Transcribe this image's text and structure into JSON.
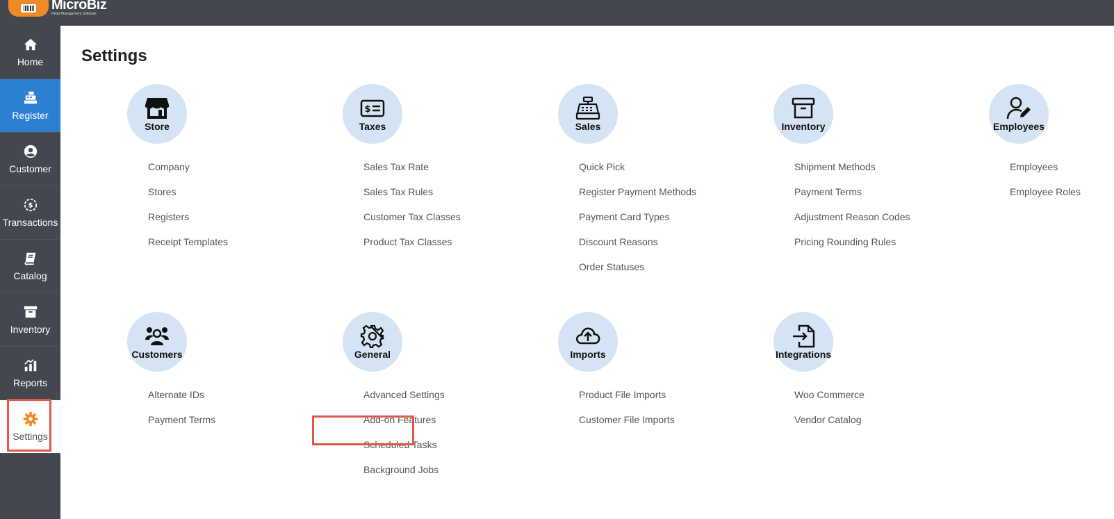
{
  "app": {
    "name": "MicroBiz",
    "tagline": "Retail Management Software"
  },
  "sidebar": {
    "items": [
      {
        "label": "Home",
        "icon": "home-icon"
      },
      {
        "label": "Register",
        "icon": "register-icon"
      },
      {
        "label": "Customer",
        "icon": "customer-icon"
      },
      {
        "label": "Transactions",
        "icon": "transactions-icon"
      },
      {
        "label": "Catalog",
        "icon": "catalog-icon"
      },
      {
        "label": "Inventory",
        "icon": "inventory-icon"
      },
      {
        "label": "Reports",
        "icon": "reports-icon"
      },
      {
        "label": "Settings",
        "icon": "gear-icon"
      }
    ]
  },
  "page": {
    "title": "Settings"
  },
  "sections": {
    "store": {
      "title": "Store",
      "icon": "store-icon",
      "links": [
        "Company",
        "Stores",
        "Registers",
        "Receipt Templates"
      ]
    },
    "taxes": {
      "title": "Taxes",
      "icon": "money-bill-icon",
      "links": [
        "Sales Tax Rate",
        "Sales Tax Rules",
        "Customer Tax Classes",
        "Product Tax Classes"
      ]
    },
    "sales": {
      "title": "Sales",
      "icon": "cash-register-icon",
      "links": [
        "Quick Pick",
        "Register Payment Methods",
        "Payment Card Types",
        "Discount Reasons",
        "Order Statuses"
      ]
    },
    "inventory": {
      "title": "Inventory",
      "icon": "archive-box-icon",
      "links": [
        "Shipment Methods",
        "Payment Terms",
        "Adjustment Reason Codes",
        "Pricing Rounding Rules"
      ]
    },
    "employees": {
      "title": "Employees",
      "icon": "user-edit-icon",
      "links": [
        "Employees",
        "Employee Roles"
      ]
    },
    "customers": {
      "title": "Customers",
      "icon": "users-group-icon",
      "links": [
        "Alternate IDs",
        "Payment Terms"
      ]
    },
    "general": {
      "title": "General",
      "icon": "gear-icon",
      "links": [
        "Advanced Settings",
        "Add-on Features",
        "Scheduled Tasks",
        "Background Jobs"
      ]
    },
    "imports": {
      "title": "Imports",
      "icon": "cloud-upload-icon",
      "links": [
        "Product File Imports",
        "Customer File Imports"
      ]
    },
    "integrations": {
      "title": "Integrations",
      "icon": "file-import-icon",
      "links": [
        "Woo Commerce",
        "Vendor Catalog"
      ]
    }
  },
  "colors": {
    "sidebar": "#434750",
    "active": "#2d7fd3",
    "circle": "#d4e4f4",
    "accent": "#f08a24",
    "highlight": "#e0574a"
  }
}
